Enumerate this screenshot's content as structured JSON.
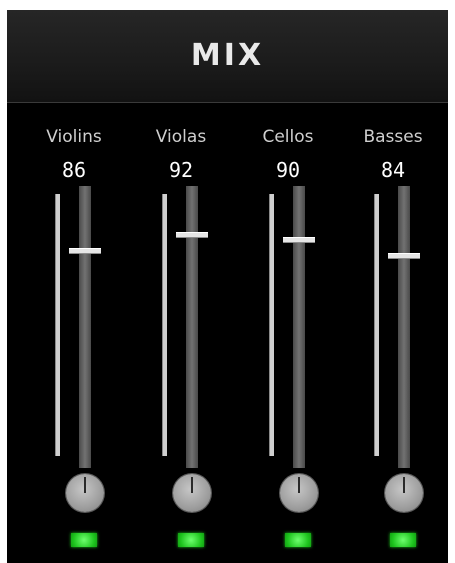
{
  "app": {
    "title": "MIX"
  },
  "channels": [
    {
      "label": "Violins",
      "value": "86",
      "fader_level": 0.86,
      "led": "on"
    },
    {
      "label": "Violas",
      "value": "92",
      "fader_level": 0.92,
      "led": "on"
    },
    {
      "label": "Cellos",
      "value": "90",
      "fader_level": 0.9,
      "led": "on"
    },
    {
      "label": "Basses",
      "value": "84",
      "fader_level": 0.84,
      "led": "on"
    }
  ],
  "colors": {
    "background": "#000000",
    "header": "#1b1b1b",
    "led_on": "#1ec41e",
    "text": "#cfcfcf"
  },
  "icons": {
    "knob": "pan-knob-icon",
    "led": "led-indicator-icon"
  }
}
